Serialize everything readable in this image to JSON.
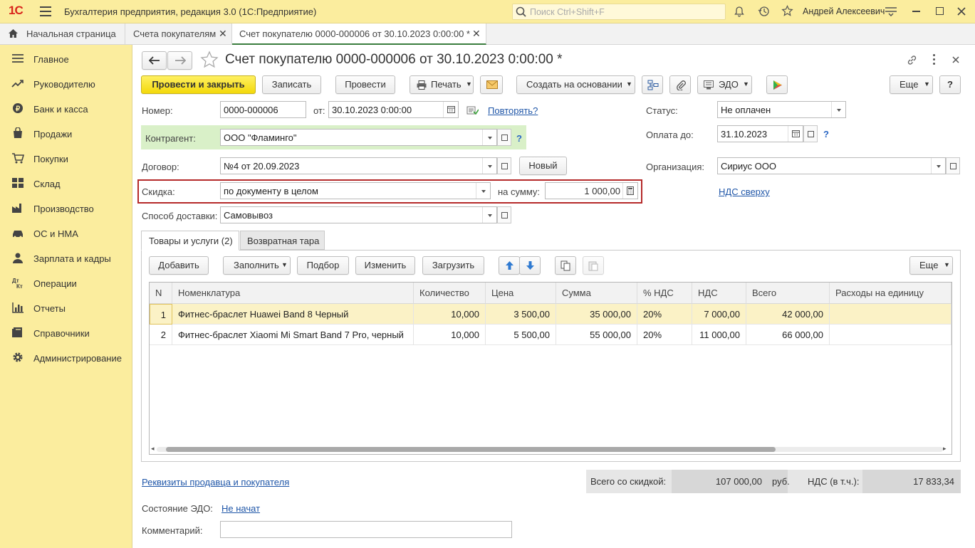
{
  "app": {
    "title": "Бухгалтерия предприятия, редакция 3.0  (1С:Предприятие)",
    "logo": "1С",
    "search_placeholder": "Поиск Ctrl+Shift+F",
    "user": "Андрей Алексеевич"
  },
  "tabs": [
    {
      "label": "Начальная страница"
    },
    {
      "label": "Счета покупателям"
    },
    {
      "label": "Счет покупателю 0000-000006 от 30.10.2023 0:00:00 *"
    }
  ],
  "sidebar": {
    "items": [
      {
        "label": "Главное",
        "icon": "menu-icon"
      },
      {
        "label": "Руководителю",
        "icon": "trend-icon"
      },
      {
        "label": "Банк и касса",
        "icon": "coin-icon"
      },
      {
        "label": "Продажи",
        "icon": "bag-icon"
      },
      {
        "label": "Покупки",
        "icon": "cart-icon"
      },
      {
        "label": "Склад",
        "icon": "grid-icon"
      },
      {
        "label": "Производство",
        "icon": "factory-icon"
      },
      {
        "label": "ОС и НМА",
        "icon": "car-icon"
      },
      {
        "label": "Зарплата и кадры",
        "icon": "person-icon"
      },
      {
        "label": "Операции",
        "icon": "dt-kt-icon"
      },
      {
        "label": "Отчеты",
        "icon": "bar-chart-icon"
      },
      {
        "label": "Справочники",
        "icon": "book-icon"
      },
      {
        "label": "Администрирование",
        "icon": "gear-icon"
      }
    ]
  },
  "form": {
    "title": "Счет покупателю 0000-000006 от 30.10.2023 0:00:00 *",
    "toolbar": {
      "post_close": "Провести и закрыть",
      "save": "Записать",
      "post": "Провести",
      "print": "Печать",
      "create_based": "Создать на основании",
      "edo": "ЭДО",
      "more": "Еще",
      "help": "?"
    },
    "number_label": "Номер:",
    "number": "0000-000006",
    "date_label": "от:",
    "date": "30.10.2023  0:00:00",
    "repeat_link": "Повторять?",
    "status_label": "Статус:",
    "status": "Не оплачен",
    "pay_until_label": "Оплата до:",
    "pay_until": "31.10.2023",
    "counterparty_label": "Контрагент:",
    "counterparty": "ООО \"Фламинго\"",
    "contract_label": "Договор:",
    "contract": "№4 от 20.09.2023",
    "new_button": "Новый",
    "org_label": "Организация:",
    "org": "Сириус ООО",
    "discount_label": "Скидка:",
    "discount_mode": "по документу в целом",
    "discount_sum_label": "на сумму:",
    "discount_sum": "1 000,00",
    "vat_link": "НДС сверху",
    "delivery_label": "Способ доставки:",
    "delivery": "Самовывоз",
    "help_mark": "?"
  },
  "subtabs": [
    {
      "label": "Товары и услуги (2)"
    },
    {
      "label": "Возвратная тара"
    }
  ],
  "table_toolbar": {
    "add": "Добавить",
    "fill": "Заполнить",
    "pick": "Подбор",
    "edit": "Изменить",
    "load": "Загрузить",
    "more": "Еще"
  },
  "table": {
    "columns": [
      "N",
      "Номенклатура",
      "Количество",
      "Цена",
      "Сумма",
      "% НДС",
      "НДС",
      "Всего",
      "Расходы на единицу"
    ],
    "rows": [
      {
        "n": "1",
        "name": "Фитнес-браслет Huawei Band 8 Черный",
        "qty": "10,000",
        "price": "3 500,00",
        "sum": "35 000,00",
        "vat_rate": "20%",
        "vat": "7 000,00",
        "total": "42 000,00",
        "cost": ""
      },
      {
        "n": "2",
        "name": "Фитнес-браслет Xiaomi Mi Smart Band 7 Pro, черный",
        "qty": "10,000",
        "price": "5 500,00",
        "sum": "55 000,00",
        "vat_rate": "20%",
        "vat": "11 000,00",
        "total": "66 000,00",
        "cost": ""
      }
    ]
  },
  "footer": {
    "requisites_link": "Реквизиты продавца и покупателя",
    "total_label": "Всего со скидкой:",
    "total": "107 000,00",
    "currency": "руб.",
    "vat_label": "НДС (в т.ч.):",
    "vat": "17 833,34",
    "edo_state_label": "Состояние ЭДО:",
    "edo_state": "Не начат",
    "comment_label": "Комментарий:",
    "comment": ""
  },
  "colors": {
    "accent_yellow": "#fbed9e",
    "primary_button": "#f3d90a",
    "highlight_border": "#b52a2a",
    "link": "#1f56a8",
    "selected_row": "#fbf2c6",
    "counterparty_bg": "#d9f0c8"
  }
}
